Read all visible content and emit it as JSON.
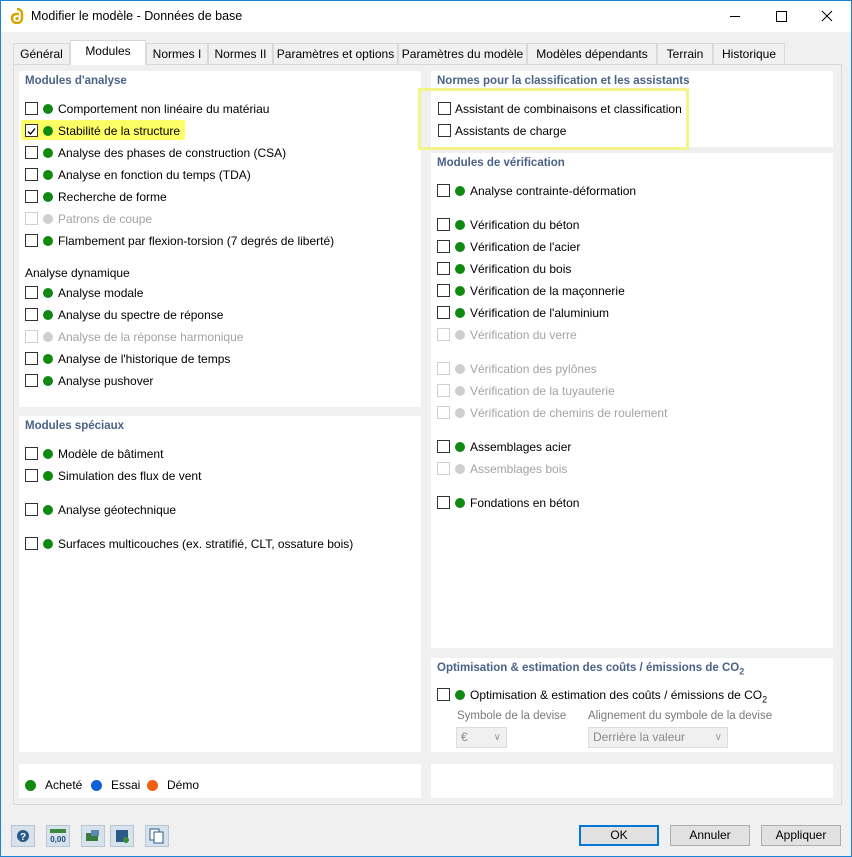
{
  "window": {
    "title": "Modifier le modèle - Données de base"
  },
  "tabs": [
    {
      "label": "Général"
    },
    {
      "label": "Modules"
    },
    {
      "label": "Normes I"
    },
    {
      "label": "Normes II"
    },
    {
      "label": "Paramètres et options"
    },
    {
      "label": "Paramètres du modèle"
    },
    {
      "label": "Modèles dépendants"
    },
    {
      "label": "Terrain"
    },
    {
      "label": "Historique"
    }
  ],
  "analysis": {
    "title": "Modules d'analyse",
    "items": [
      {
        "label": "Comportement non linéaire du matériau",
        "checked": false,
        "enabled": true,
        "status": "acheté"
      },
      {
        "label": "Stabilité de la structure",
        "checked": true,
        "enabled": true,
        "status": "acheté"
      },
      {
        "label": "Analyse des phases de construction (CSA)",
        "checked": false,
        "enabled": true,
        "status": "acheté"
      },
      {
        "label": "Analyse en fonction du temps (TDA)",
        "checked": false,
        "enabled": true,
        "status": "acheté"
      },
      {
        "label": "Recherche de forme",
        "checked": false,
        "enabled": true,
        "status": "acheté"
      },
      {
        "label": "Patrons de coupe",
        "checked": false,
        "enabled": false,
        "status": "none"
      },
      {
        "label": "Flambement par flexion-torsion (7 degrés de liberté)",
        "checked": false,
        "enabled": true,
        "status": "acheté"
      }
    ],
    "dynamic_title": "Analyse dynamique",
    "dynamic_items": [
      {
        "label": "Analyse modale",
        "checked": false,
        "enabled": true,
        "status": "acheté"
      },
      {
        "label": "Analyse du spectre de réponse",
        "checked": false,
        "enabled": true,
        "status": "acheté"
      },
      {
        "label": "Analyse de la réponse harmonique",
        "checked": false,
        "enabled": false,
        "status": "none"
      },
      {
        "label": "Analyse de l'historique de temps",
        "checked": false,
        "enabled": true,
        "status": "acheté"
      },
      {
        "label": "Analyse pushover",
        "checked": false,
        "enabled": true,
        "status": "acheté"
      }
    ]
  },
  "special": {
    "title": "Modules spéciaux",
    "items": [
      {
        "label": "Modèle de bâtiment",
        "checked": false,
        "enabled": true,
        "status": "acheté"
      },
      {
        "label": "Simulation des flux de vent",
        "checked": false,
        "enabled": true,
        "status": "acheté"
      },
      {
        "label": "Analyse géotechnique",
        "checked": false,
        "enabled": true,
        "status": "acheté"
      },
      {
        "label": "Surfaces multicouches (ex. stratifié, CLT, ossature bois)",
        "checked": false,
        "enabled": true,
        "status": "acheté"
      }
    ]
  },
  "norms": {
    "title": "Normes pour la classification et les assistants",
    "items": [
      {
        "label": "Assistant de combinaisons et classification",
        "checked": false
      },
      {
        "label": "Assistants de charge",
        "checked": false
      }
    ]
  },
  "verification": {
    "title": "Modules de vérification",
    "items": [
      {
        "label": "Analyse contrainte-déformation",
        "checked": false,
        "enabled": true,
        "status": "acheté"
      },
      {
        "label": "Vérification du béton",
        "checked": false,
        "enabled": true,
        "status": "acheté"
      },
      {
        "label": "Vérification de l'acier",
        "checked": false,
        "enabled": true,
        "status": "acheté"
      },
      {
        "label": "Vérification du bois",
        "checked": false,
        "enabled": true,
        "status": "acheté"
      },
      {
        "label": "Vérification de la maçonnerie",
        "checked": false,
        "enabled": true,
        "status": "acheté"
      },
      {
        "label": "Vérification de l'aluminium",
        "checked": false,
        "enabled": true,
        "status": "acheté"
      },
      {
        "label": "Vérification du verre",
        "checked": false,
        "enabled": false,
        "status": "none"
      },
      {
        "label": "Vérification des pylônes",
        "checked": false,
        "enabled": false,
        "status": "none"
      },
      {
        "label": "Vérification de la tuyauterie",
        "checked": false,
        "enabled": false,
        "status": "none"
      },
      {
        "label": "Vérification de chemins de roulement",
        "checked": false,
        "enabled": false,
        "status": "none"
      },
      {
        "label": "Assemblages acier",
        "checked": false,
        "enabled": true,
        "status": "acheté"
      },
      {
        "label": "Assemblages bois",
        "checked": false,
        "enabled": false,
        "status": "none"
      },
      {
        "label": "Fondations en béton",
        "checked": false,
        "enabled": true,
        "status": "acheté"
      }
    ]
  },
  "optimization": {
    "title": "Optimisation & estimation des coûts / émissions de CO",
    "title_sub": "2",
    "item_label": "Optimisation & estimation des coûts / émissions de CO",
    "item_sub": "2",
    "currency_label": "Symbole de la devise",
    "currency_value": "€",
    "alignment_label": "Alignement du symbole de la devise",
    "alignment_value": "Derrière la valeur"
  },
  "legend": {
    "purchased": "Acheté",
    "trial": "Essai",
    "demo": "Démo"
  },
  "colors": {
    "purchased": "#0f8a0f",
    "trial": "#1060d8",
    "demo": "#f06010",
    "highlight": "#ffff66",
    "accent": "#0078d7"
  },
  "toolbar_icons": [
    "help-icon",
    "units-icon",
    "model-icon",
    "settings-icon",
    "copy-icon"
  ],
  "units_icon_text": "0,00",
  "buttons": {
    "ok": "OK",
    "cancel": "Annuler",
    "apply": "Appliquer"
  }
}
